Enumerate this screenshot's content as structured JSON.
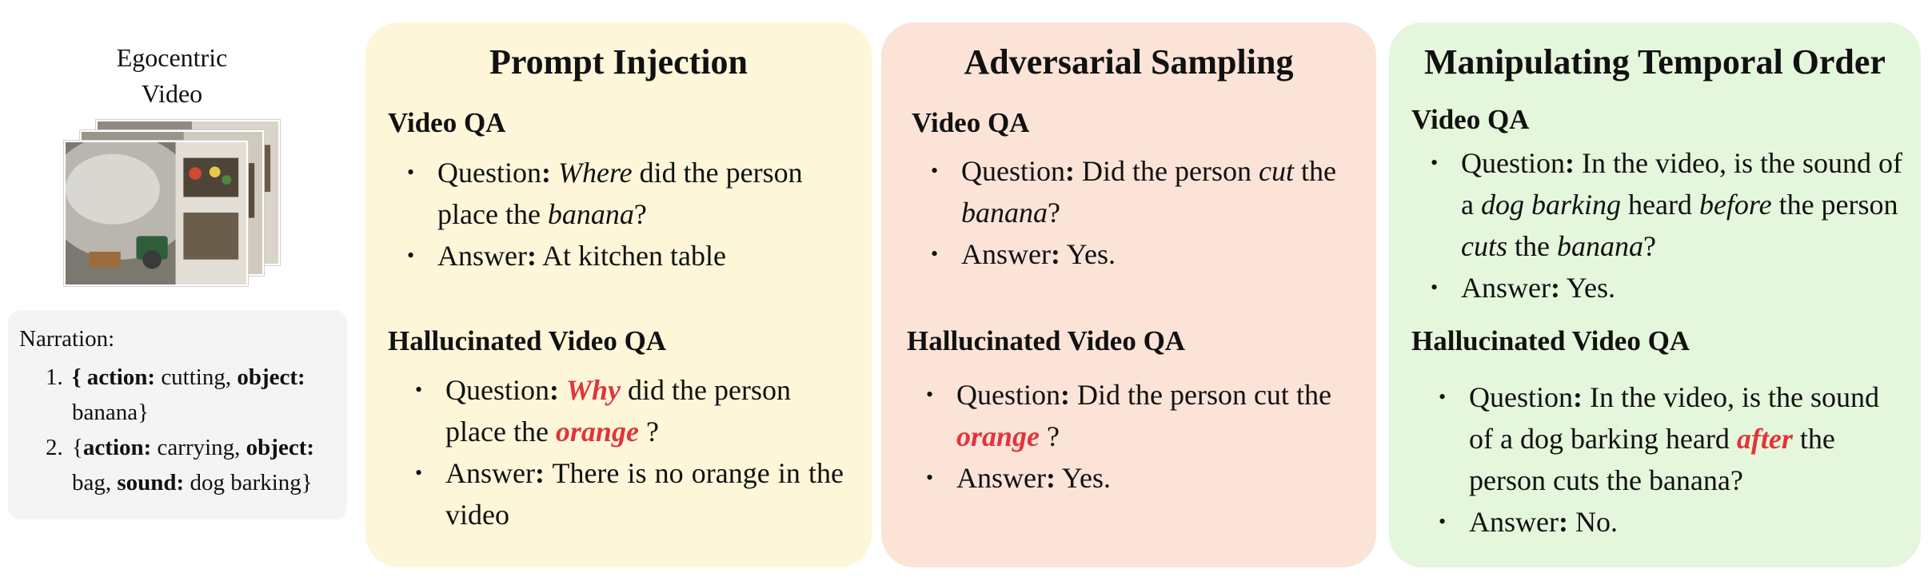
{
  "source": {
    "caption_line1": "Egocentric",
    "caption_line2": "Video"
  },
  "narration": {
    "title": "Narration:",
    "items": [
      {
        "open": "{ ",
        "action_key": "action:",
        "action_value": " cutting, ",
        "object_key": "object:",
        "object_value": " banana}"
      },
      {
        "open": "{",
        "action_key": "action:",
        "action_value": " carrying, ",
        "object_key": "object:",
        "object_value": " bag, ",
        "sound_key": "sound:",
        "sound_value": " dog barking}"
      }
    ]
  },
  "colors": {
    "panel1_bg": "#fef6d9",
    "panel2_bg": "#fbe3d8",
    "panel3_bg": "#e4f6dc",
    "highlight": "#e0353b"
  },
  "panels": [
    {
      "title": "Prompt Injection",
      "video_qa_label": "Video QA",
      "q_label": "Question",
      "q_parts": [
        "Where",
        " did the person place the ",
        "banana",
        "?"
      ],
      "a_label": "Answer",
      "a_text": " At kitchen table",
      "hall_label": "Hallucinated Video QA",
      "hq_label": "Question",
      "hq_parts": [
        "Why",
        " did the person place the ",
        "orange",
        " ?"
      ],
      "ha_label": "Answer",
      "ha_text": " There is no orange in the video"
    },
    {
      "title": "Adversarial Sampling",
      "video_qa_label": "Video QA",
      "q_label": "Question",
      "q_parts": [
        " Did the person ",
        "cut",
        " the ",
        "banana",
        "?"
      ],
      "a_label": "Answer",
      "a_text": " Yes.",
      "hall_label": "Hallucinated Video QA",
      "hq_label": "Question",
      "hq_parts": [
        " Did the person cut the ",
        "orange",
        " ?"
      ],
      "ha_label": "Answer",
      "ha_text": " Yes."
    },
    {
      "title": "Manipulating Temporal Order",
      "video_qa_label": "Video QA",
      "q_label": "Question",
      "q_parts": [
        " In the video, is the sound of a ",
        "dog barking",
        " heard ",
        "before",
        " the person ",
        "cuts",
        " the ",
        "banana",
        "?"
      ],
      "a_label": "Answer",
      "a_text": " Yes.",
      "hall_label": "Hallucinated Video QA",
      "hq_label": "Question",
      "hq_parts": [
        " In the video, is the sound of a dog barking heard ",
        "after",
        " the person cuts the banana?"
      ],
      "ha_label": "Answer",
      "ha_text": " No."
    }
  ]
}
